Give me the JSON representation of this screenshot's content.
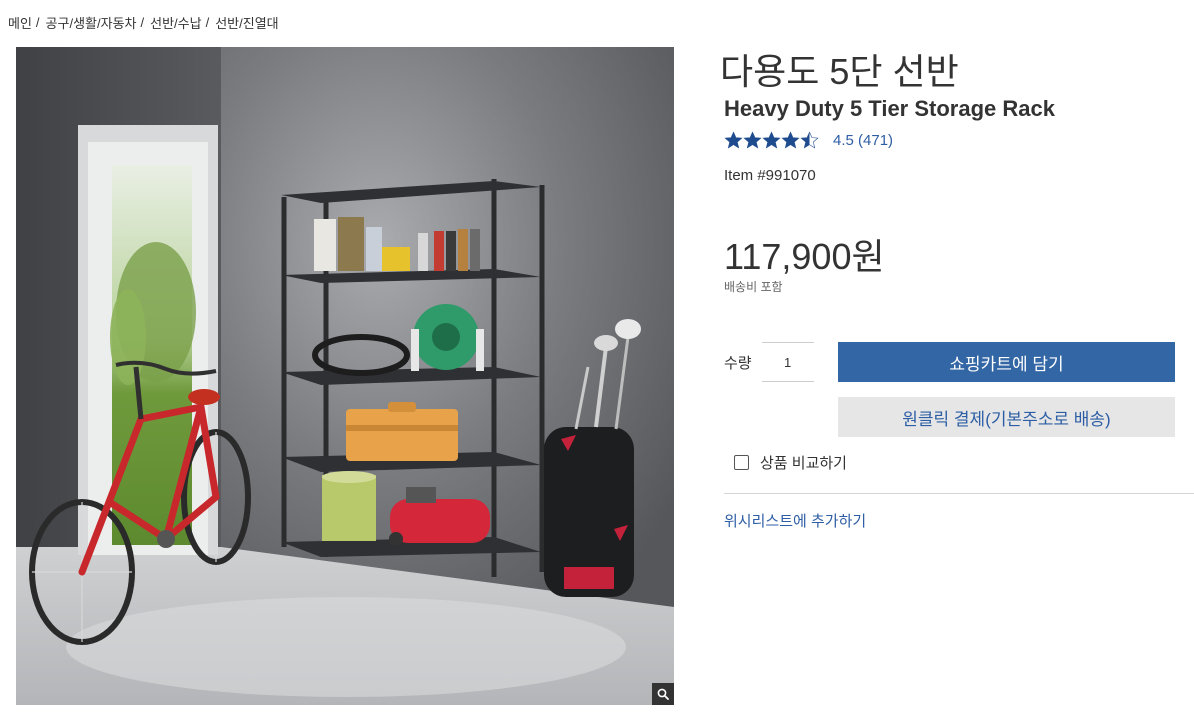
{
  "breadcrumb": {
    "items": [
      "메인",
      "공구/생활/자동차",
      "선반/수납",
      "선반/진열대"
    ],
    "separator": "/"
  },
  "product": {
    "title_ko": "다용도 5단 선반",
    "title_en": "Heavy Duty 5 Tier Storage Rack",
    "rating_value": 4.5,
    "rating_text": "4.5",
    "review_count": "(471)",
    "item_number": "Item #991070",
    "price": "117,900원",
    "shipping_note": "배송비 포함"
  },
  "purchase": {
    "qty_label": "수량",
    "qty_value": "1",
    "add_to_cart_label": "쇼핑카트에 담기",
    "one_click_label": "원클릭 결제(기본주소로 배송)",
    "compare_label": "상품 비교하기",
    "compare_checked": false,
    "wishlist_label": "위시리스트에 추가하기"
  },
  "colors": {
    "primary_button": "#3366a4",
    "link": "#2d5ea5",
    "star": "#1f4b8f",
    "secondary_button_bg": "#e6e6e6"
  },
  "icons": {
    "zoom": "magnifier-icon",
    "star": "star-icon",
    "checkbox": "checkbox-icon"
  }
}
